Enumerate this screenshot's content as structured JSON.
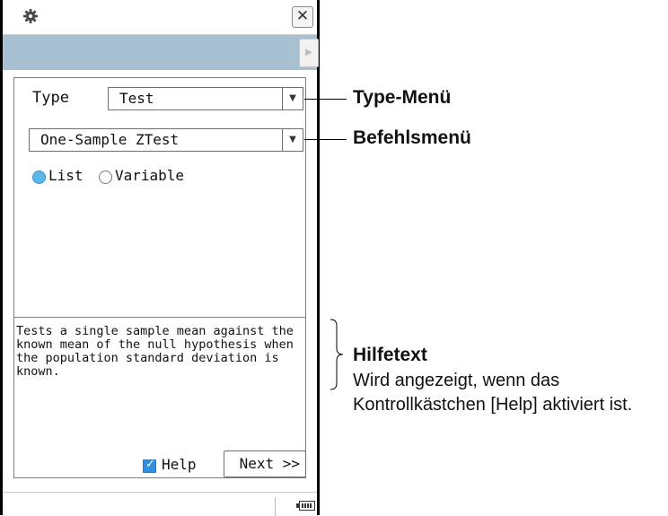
{
  "window": {
    "icons": {
      "settings": "gear-icon",
      "close": "close-icon"
    },
    "close_glyph": "✕",
    "toolbar_arrow_glyph": "▶"
  },
  "form": {
    "type_label": "Type",
    "type_value": "Test",
    "command_value": "One-Sample ZTest",
    "dropdown_arrow_glyph": "▼",
    "radio_options": [
      {
        "label": "List",
        "selected": true
      },
      {
        "label": "Variable",
        "selected": false
      }
    ],
    "help_text": "Tests a single sample mean against the known mean of the null hypothesis when the population standard deviation is known.",
    "help_checkbox": {
      "label": "Help",
      "checked": true,
      "check_glyph": "✓"
    },
    "next_button": "Next >>"
  },
  "annotations": {
    "type_menu": "Type-Menü",
    "command_menu": "Befehlsmenü",
    "help_title": "Hilfetext",
    "help_desc": "Wird angezeigt, wenn das Kontrollkästchen [Help] aktiviert ist."
  },
  "colors": {
    "toolbar": "#a8c1d2",
    "radio_selected": "#5ab7e8",
    "checkbox": "#2f8fe0"
  }
}
